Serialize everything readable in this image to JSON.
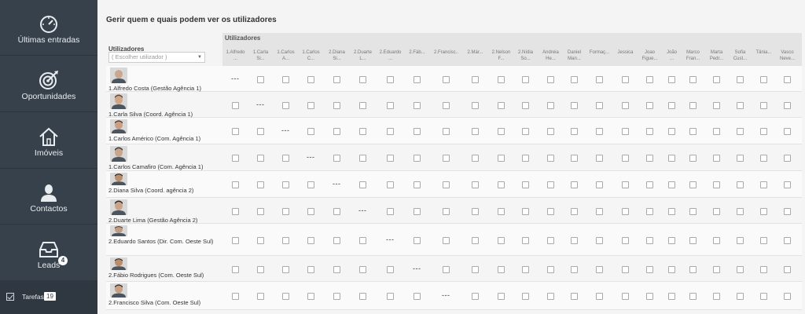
{
  "sidebar": {
    "items": [
      {
        "label": "Últimas entradas",
        "icon": "gauge-icon"
      },
      {
        "label": "Oportunidades",
        "icon": "target-icon"
      },
      {
        "label": "Imóveis",
        "icon": "house-icon"
      },
      {
        "label": "Contactos",
        "icon": "person-icon"
      },
      {
        "label": "Leads",
        "icon": "inbox-icon",
        "badge": "4"
      }
    ],
    "tasks": {
      "label": "Tarefas",
      "count": "19"
    }
  },
  "page": {
    "title": "Gerir quem e quais podem ver os utilizadores",
    "grid_title": "Utilizadores",
    "users_title": "Utilizadores",
    "user_select_placeholder": "( Escolher utilizador )"
  },
  "columns": [
    [
      "1.Alfredo",
      "..."
    ],
    [
      "1.Carla",
      "Si..."
    ],
    [
      "1.Carlos",
      "A..."
    ],
    [
      "1.Carlos",
      "C..."
    ],
    [
      "2.Diana",
      "Si..."
    ],
    [
      "2.Duarte",
      "L..."
    ],
    [
      "2.Eduardo",
      "..."
    ],
    [
      "2.Fáb...",
      ""
    ],
    [
      "2.Francisc...",
      ""
    ],
    [
      "2.Már...",
      ""
    ],
    [
      "2.Nelson",
      "F..."
    ],
    [
      "2.Nídia",
      "So..."
    ],
    [
      "Andreia",
      "He..."
    ],
    [
      "Daniel",
      "Man..."
    ],
    [
      "Formaç...",
      ""
    ],
    [
      "Jessica",
      ""
    ],
    [
      "Joao",
      "Figue..."
    ],
    [
      "João",
      "..."
    ],
    [
      "Marco",
      "Fran..."
    ],
    [
      "Marta",
      "Pedr..."
    ],
    [
      "Sofia",
      "Cust..."
    ],
    [
      "Tânia...",
      ""
    ],
    [
      "Vasco",
      "Neve..."
    ]
  ],
  "rows": [
    {
      "name": "1.Alfredo Costa (Gestão Agência 1)",
      "self_col": 0
    },
    {
      "name": "1.Carla Silva (Coord. Agência 1)",
      "self_col": 1
    },
    {
      "name": "1.Carlos Américo (Com. Agência 1)",
      "self_col": 2
    },
    {
      "name": "1.Carlos Camafiro (Com. Agência 1)",
      "self_col": 3
    },
    {
      "name": "2.Diana Silva (Coord. agência 2)",
      "self_col": 4
    },
    {
      "name": "2.Duarte Lima (Gestão Agência 2)",
      "self_col": 5
    },
    {
      "name": "2.Eduardo Santos (Dir. Com. Oeste Sul)",
      "self_col": 6
    },
    {
      "name": "2.Fábio Rodrigues (Com. Oeste Sul)",
      "self_col": 7
    },
    {
      "name": "2.Francisco Silva (Com. Oeste Sul)",
      "self_col": 8
    }
  ],
  "self_marker": "---",
  "colors": {
    "sidebar": "#37414b",
    "accent": "#ffffff"
  }
}
